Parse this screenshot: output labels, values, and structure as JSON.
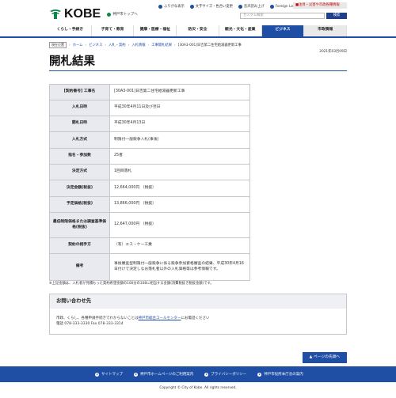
{
  "header": {
    "logo_text": "KOBE",
    "site_sub": "神戸市トップへ",
    "utils": [
      "ふりがな表示",
      "文字サイズ・色合い変更",
      "音声読み上げ",
      "Foreign Language"
    ],
    "emergency": "注目・災害や市政各種情報",
    "search_placeholder": "カスタム検索",
    "search_button": "検索"
  },
  "gnav": [
    "くらし・手続き",
    "子育て・教育",
    "健康・医療・福祉",
    "防災・安全",
    "観光・文化・産業",
    "ビジネス",
    "市政情報"
  ],
  "breadcrumb": [
    "ホーム",
    "ビジネス",
    "入札・契約",
    "入札情報",
    "工事開札結果",
    "[30A3-001]日吉第二住宅給湯器更新工事"
  ],
  "breadcrumb_home_label": "現在位置",
  "updated_date": "2021年03月09日",
  "page_title": "開札結果",
  "table": [
    {
      "label": "[契約番号] 工事名",
      "value": "[30A3-001]日吉第二住宅給湯器更新工事"
    },
    {
      "label": "入札日時",
      "value": "平成30年4月11日及び翌日"
    },
    {
      "label": "開札日時",
      "value": "平成30年4月13日"
    },
    {
      "label": "入札方式",
      "value": "制限付一般競争入札(事後)"
    },
    {
      "label": "指名・参加数",
      "value": "25者"
    },
    {
      "label": "決定方式",
      "value": "1回目落札"
    },
    {
      "label": "決定金額(税抜)",
      "value": "12,664,000円 （税抜）"
    },
    {
      "label": "予定価格(税抜)",
      "value": "13,866,000円 （税抜）"
    },
    {
      "label": "最低制限価格または調査基準価格(税抜)",
      "value": "12,647,000円 （税抜）"
    },
    {
      "label": "契約の相手方",
      "value": "（有）エス・ケー工業"
    },
    {
      "label": "備考",
      "value": "事後審査型制限付一般競争に係る競争参加資格審査の結果、平成30年4月16日付けで決定しなお落札者以外の入札価格等は参考情報です。"
    }
  ],
  "note": "※上記金額は、入札者が見積もった契約希望金額の100分の108に相当する金額(消費税抜き税抜金額)です。",
  "contact": {
    "heading": "お問い合わせ先",
    "line1_pre": "市政、くらし、各種申請手続きでわからないことは",
    "line1_link": "神戸市総合コールセンター",
    "line1_post": "にお電話ください",
    "line2": "電話 078-333-3330 Fax 078-333-3314"
  },
  "to_top": "ページの先頭へ",
  "footer_links": [
    "サイトマップ",
    "神戸市ホームページのご利用案内",
    "プライバシーポリシー",
    "神戸市役所本庁舎の案内"
  ],
  "copyright": "Copyright © City of Kobe. All rights reserved."
}
